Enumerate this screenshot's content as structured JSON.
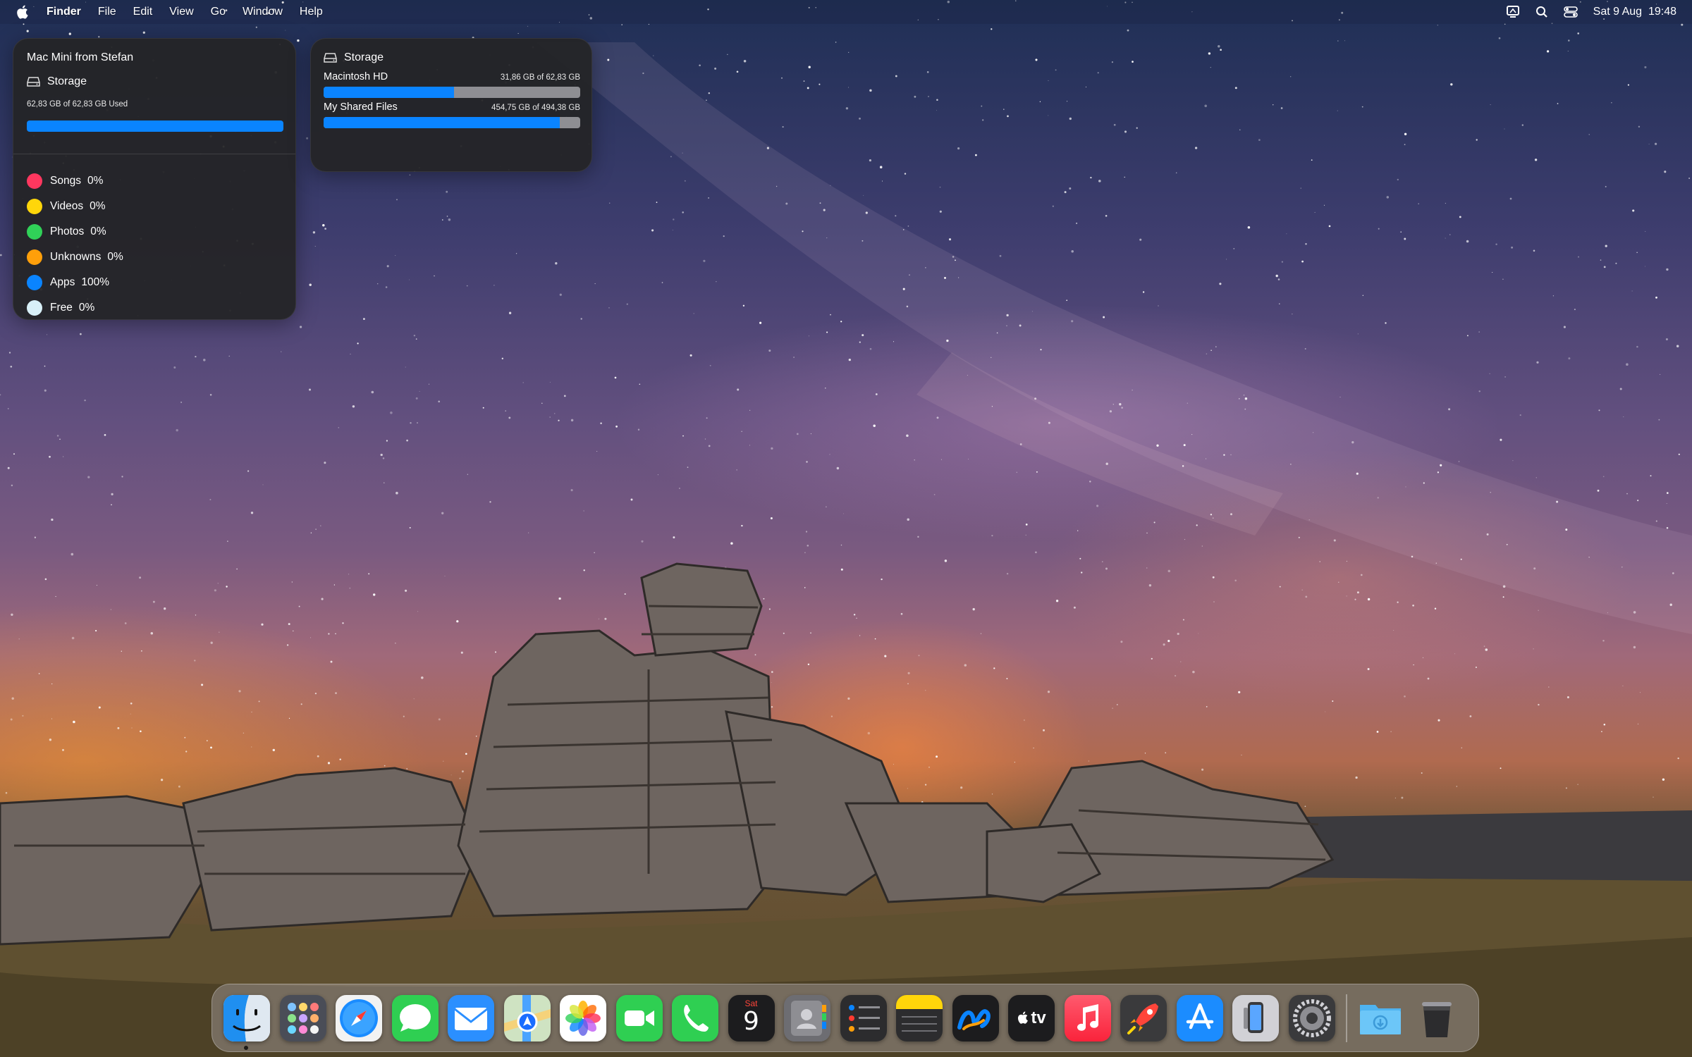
{
  "menubar": {
    "app_name": "Finder",
    "menus": [
      "File",
      "Edit",
      "View",
      "Go",
      "Window",
      "Help"
    ],
    "date": "Sat 9 Aug",
    "time": "19:48",
    "status_icons": [
      "display-icon",
      "search-icon",
      "control-center-icon"
    ]
  },
  "widget_main": {
    "device": "Mac Mini from Stefan",
    "storage_label": "Storage",
    "used_text": "62,83 GB of 62,83 GB Used",
    "used_fraction": 1.0,
    "legend": [
      {
        "label": "Songs",
        "value": "0%",
        "color": "#ff375f"
      },
      {
        "label": "Videos",
        "value": "0%",
        "color": "#ffd60a"
      },
      {
        "label": "Photos",
        "value": "0%",
        "color": "#30d158"
      },
      {
        "label": "Unknowns",
        "value": "0%",
        "color": "#ff9f0a"
      },
      {
        "label": "Apps",
        "value": "100%",
        "color": "#0a84ff"
      },
      {
        "label": "Free",
        "value": "0%",
        "color": "#d8f0f8"
      }
    ]
  },
  "widget_volumes": {
    "title": "Storage",
    "volumes": [
      {
        "name": "Macintosh HD",
        "amount": "31,86 GB of 62,83 GB",
        "fraction": 0.507
      },
      {
        "name": "My Shared Files",
        "amount": "454,75 GB of 494,38 GB",
        "fraction": 0.92
      }
    ]
  },
  "dock": {
    "apps": [
      "Finder",
      "Launchpad",
      "Safari",
      "Messages",
      "Mail",
      "Maps",
      "Photos",
      "FaceTime",
      "Phone",
      "Calendar",
      "Contacts",
      "Reminders",
      "Notes",
      "Freeform",
      "TV",
      "Music",
      "Rocket",
      "App Store",
      "iPhone Mirroring",
      "System Settings"
    ],
    "calendar_day": "Sat",
    "calendar_date": "9",
    "tv_label": "tv",
    "extras": [
      "Downloads",
      "Trash"
    ]
  },
  "colors": {
    "accent": "#0a84ff",
    "widget_bg": "#242426"
  }
}
